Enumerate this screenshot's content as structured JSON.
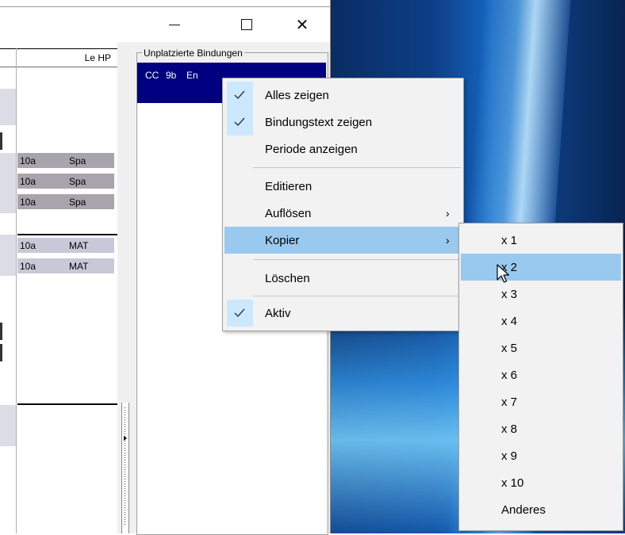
{
  "window": {
    "controls": {
      "minimize": "minimize",
      "maximize": "maximize",
      "close": "✕"
    }
  },
  "grid": {
    "header": "Le HP",
    "rows": [
      {
        "c1": "10a",
        "c2": "Spa",
        "shade": "dark"
      },
      {
        "c1": "10a",
        "c2": "Spa",
        "shade": "dark"
      },
      {
        "c1": "10a",
        "c2": "Spa",
        "shade": "dark"
      },
      {
        "c1": "10a",
        "c2": "MAT",
        "shade": "light"
      },
      {
        "c1": "10a",
        "c2": "MAT",
        "shade": "light"
      }
    ]
  },
  "unplaced": {
    "title": "Unplatzierte Bindungen",
    "item": {
      "a": "CC",
      "b": "9b",
      "c": "En"
    }
  },
  "context_menu": {
    "items": [
      {
        "label": "Alles zeigen",
        "checked": true
      },
      {
        "label": "Bindungstext zeigen",
        "checked": true
      },
      {
        "label": "Periode anzeigen",
        "checked": false
      },
      {
        "label": "Editieren",
        "checked": false
      },
      {
        "label": "Auflösen",
        "checked": false,
        "submenu": "›"
      },
      {
        "label": "Kopier",
        "checked": false,
        "submenu": "›",
        "highlighted": true
      },
      {
        "label": "Löschen",
        "checked": false
      },
      {
        "label": "Aktiv",
        "checked": true
      }
    ]
  },
  "submenu": {
    "items": [
      "x 1",
      "x 2",
      "x 3",
      "x 4",
      "x 5",
      "x 6",
      "x 7",
      "x 8",
      "x 9",
      "x 10",
      "Anderes"
    ],
    "highlighted_index": 1
  },
  "colors": {
    "highlight": "#99c9ef",
    "check_bg": "#cce8ff",
    "selected_item": "#000080"
  }
}
